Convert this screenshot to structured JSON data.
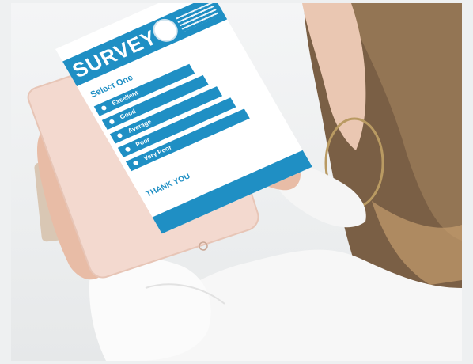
{
  "survey": {
    "title": "SURVEY",
    "prompt": "Select One",
    "options": [
      {
        "label": "Excellent"
      },
      {
        "label": "Good"
      },
      {
        "label": "Average"
      },
      {
        "label": "Poor"
      },
      {
        "label": "Very Poor"
      }
    ],
    "closing": "THANK YOU"
  },
  "colors": {
    "accent": "#1f8fc4",
    "background": "#eef0f1",
    "tablet_frame": "#f3d9cf"
  },
  "icons": [
    "home-button-icon",
    "seal-logo-icon",
    "radio-dot-icon"
  ]
}
